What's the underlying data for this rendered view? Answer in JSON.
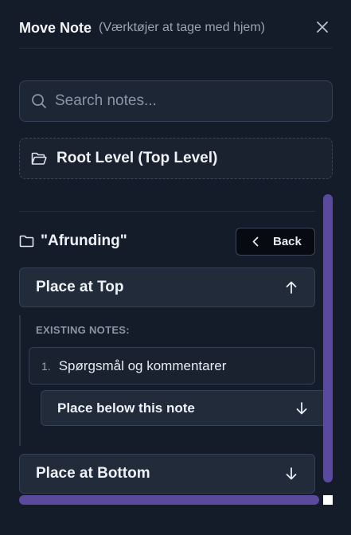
{
  "header": {
    "title": "Move Note",
    "subtitle": "(Værktøjer at tage med hjem)"
  },
  "search": {
    "placeholder": "Search notes...",
    "value": ""
  },
  "root_option": {
    "label": "Root Level (Top Level)"
  },
  "current_folder": {
    "name": "\"Afrunding\"",
    "back_label": "Back"
  },
  "actions": {
    "place_top": "Place at Top",
    "place_bottom": "Place at Bottom",
    "place_below": "Place below this note"
  },
  "existing_notes": {
    "heading": "EXISTING NOTES:",
    "items": [
      {
        "number": "1.",
        "title": "Spørgsmål og kommentarer"
      }
    ]
  },
  "icons": [
    "close-icon",
    "search-icon",
    "folder-open-icon",
    "folder-icon",
    "chevron-left-icon",
    "arrow-up-icon",
    "arrow-down-icon"
  ],
  "colors": {
    "background": "#151c29",
    "scrollbar": "#5a4a9e"
  }
}
